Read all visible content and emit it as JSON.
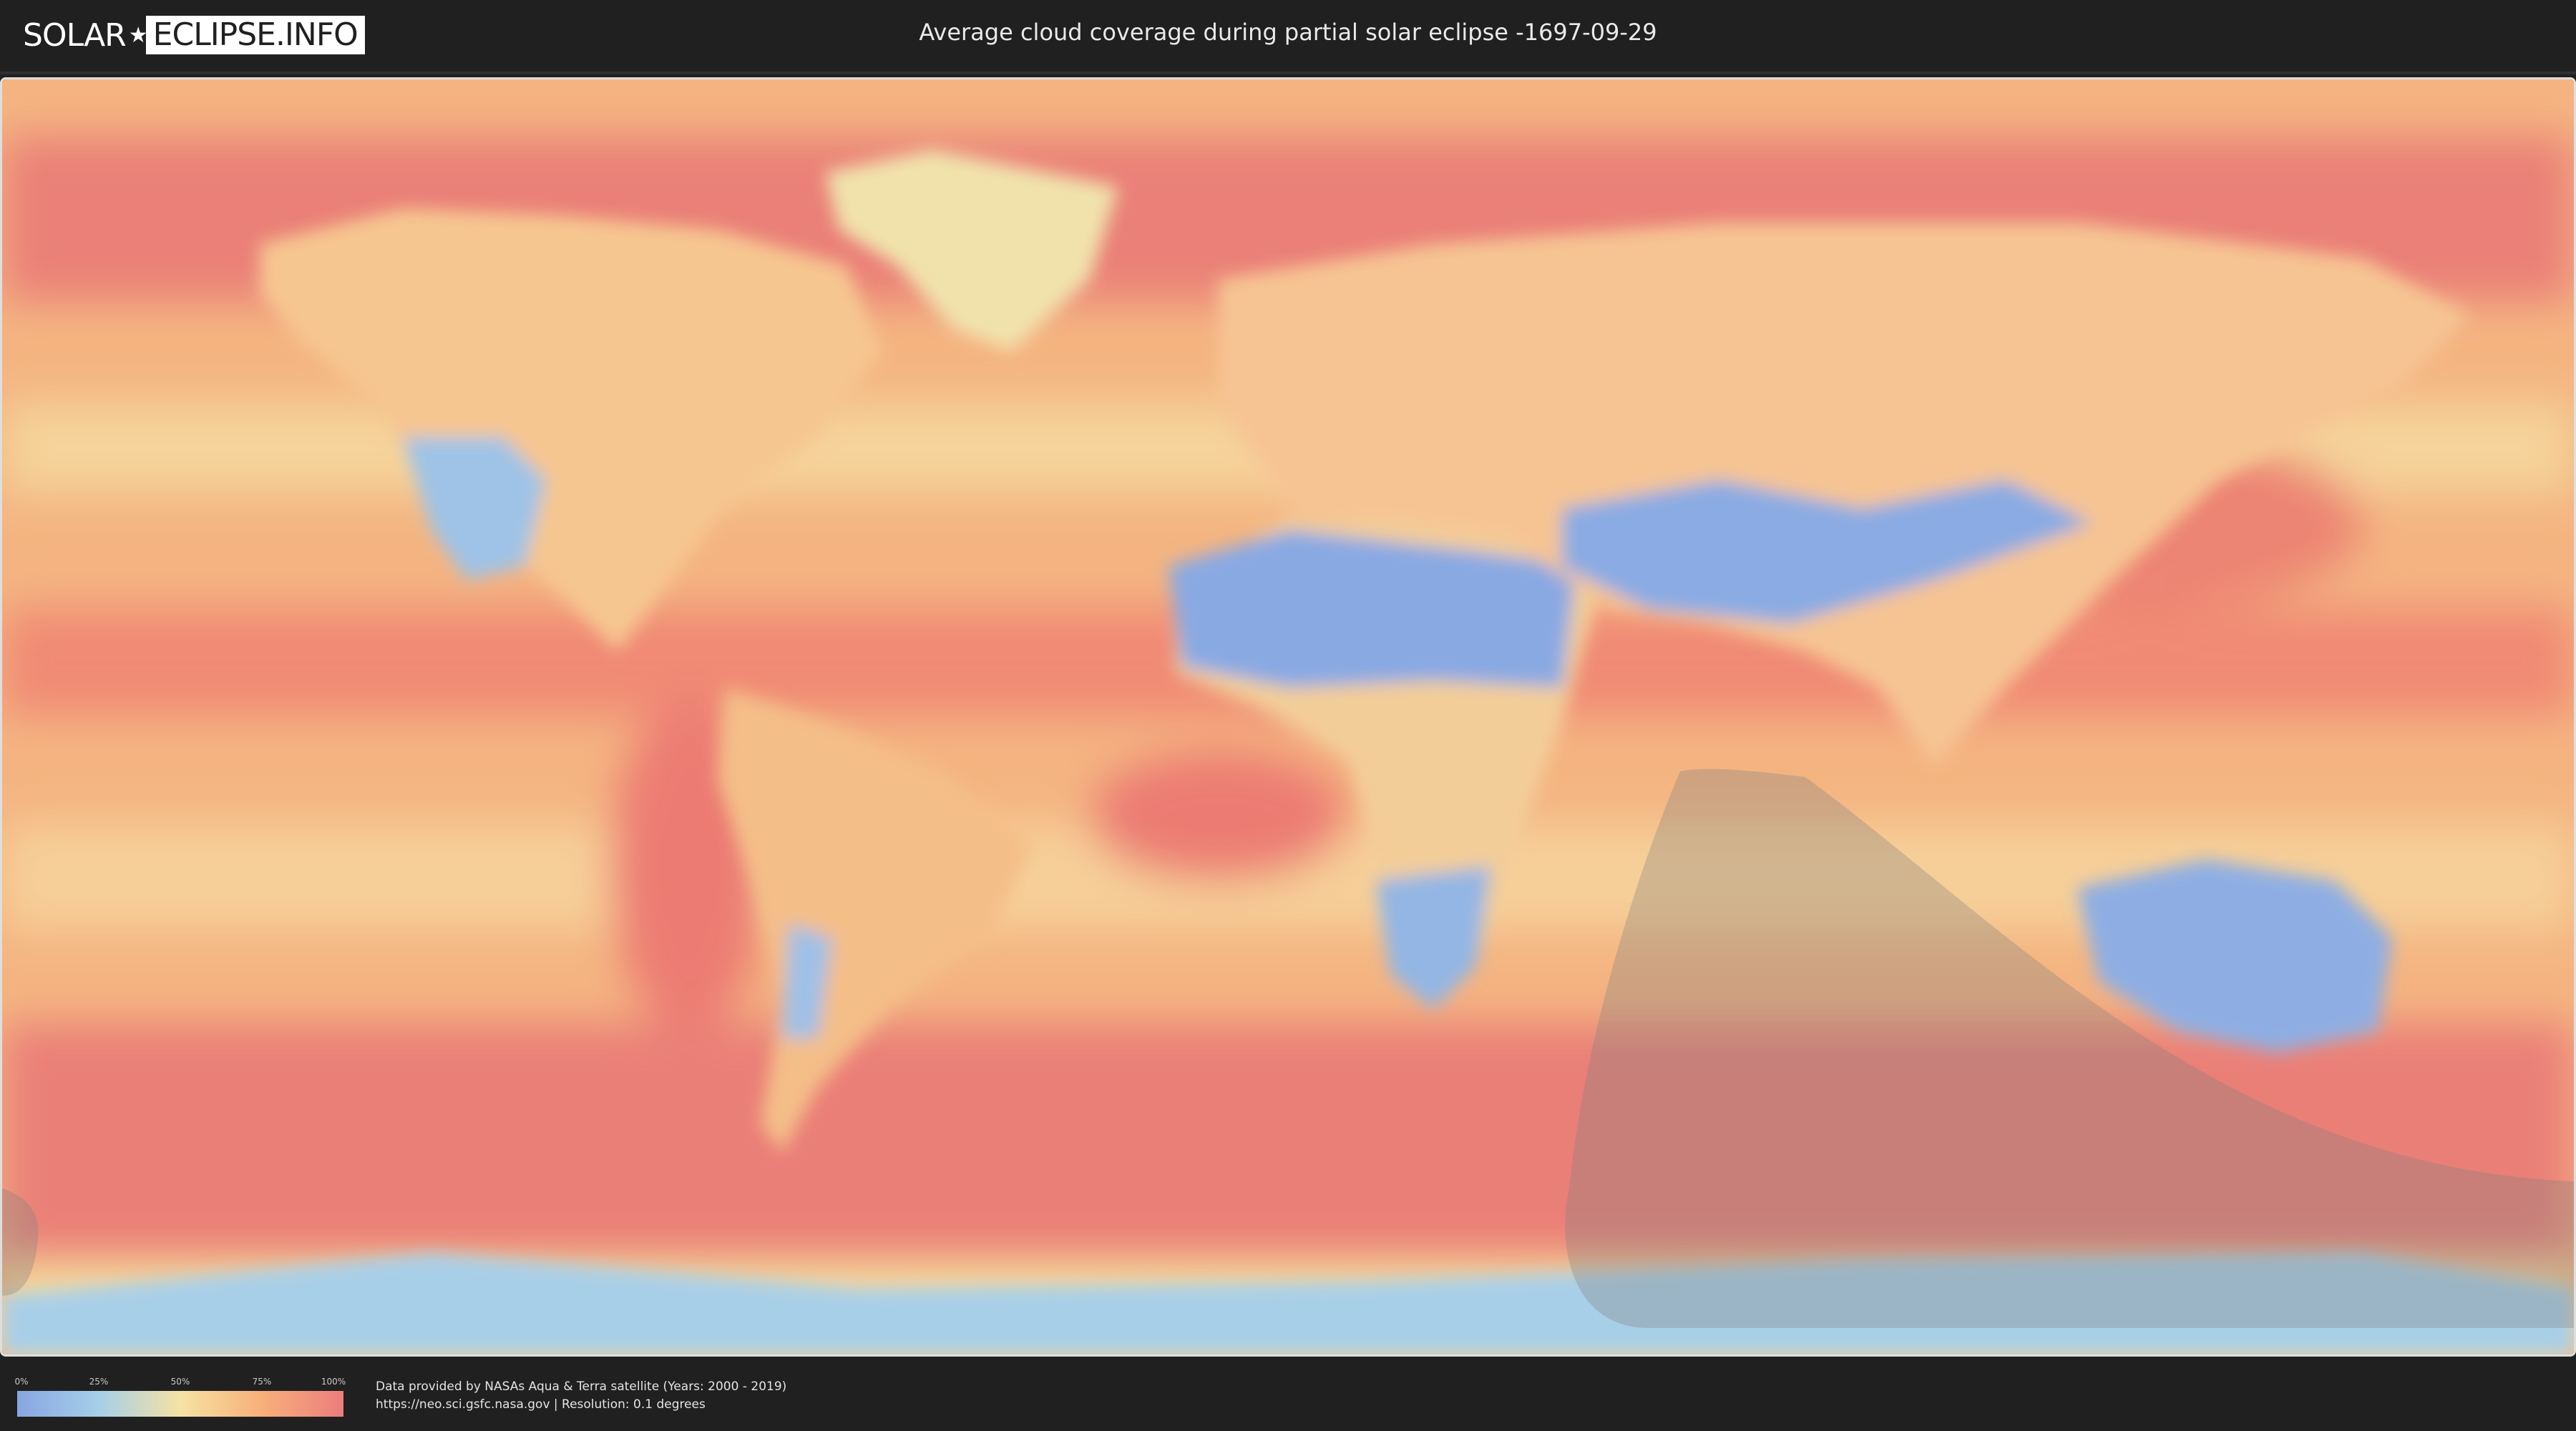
{
  "header": {
    "logo_part1": "SOLAR",
    "logo_part2": "ECLIPSE.INFO",
    "title": "Average cloud coverage during partial solar eclipse -1697-09-29"
  },
  "legend": {
    "ticks": [
      "0%",
      "25%",
      "50%",
      "75%",
      "100%"
    ],
    "colors": [
      "#88a6e2",
      "#a6cfe8",
      "#f5e2a4",
      "#f7b07a",
      "#ec7d7d"
    ]
  },
  "footer": {
    "credit_line": "Data provided by NASAs Aqua & Terra satellite (Years: 2000 - 2019)",
    "source_line": "https://neo.sci.gsfc.nasa.gov | Resolution: 0.1 degrees"
  },
  "map": {
    "projection": "equirectangular",
    "ocean_color": "#f4b481",
    "cloudy_color": "#ea8276",
    "clear_color": "#8daee3",
    "eclipse_shadow_color": "#808080"
  }
}
